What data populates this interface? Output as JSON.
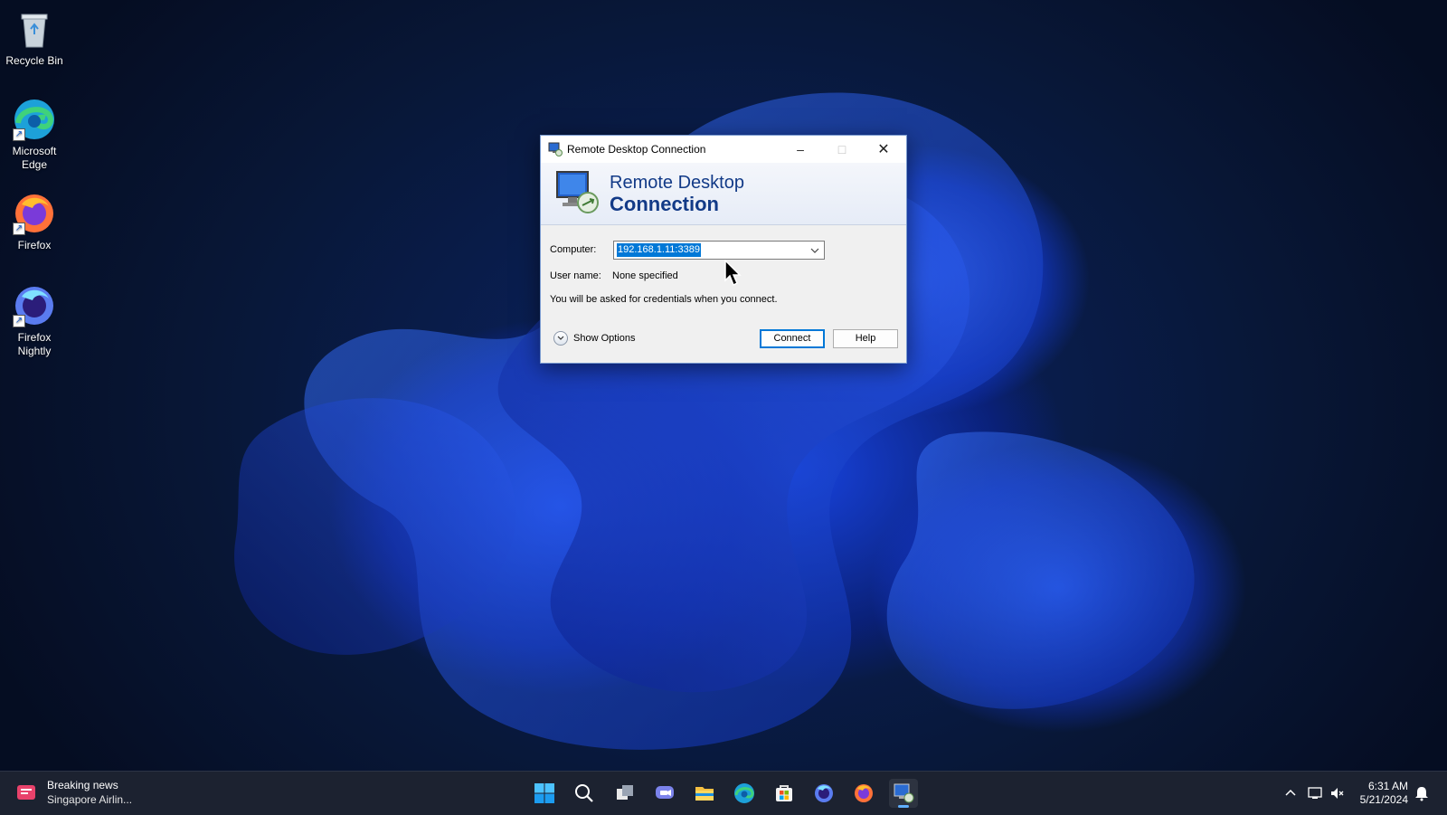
{
  "desktop": {
    "icons": [
      {
        "label": "Recycle Bin"
      },
      {
        "label": "Microsoft Edge"
      },
      {
        "label": "Firefox"
      },
      {
        "label": "Firefox Nightly"
      }
    ]
  },
  "dialog": {
    "title": "Remote Desktop Connection",
    "banner_line1": "Remote Desktop",
    "banner_line2": "Connection",
    "computer_label": "Computer:",
    "computer_value": "192.168.1.11:3389",
    "username_label": "User name:",
    "username_value": "None specified",
    "credentials_note": "You will be asked for credentials when you connect.",
    "show_options_label": "Show Options",
    "connect_label": "Connect",
    "help_label": "Help"
  },
  "taskbar": {
    "news_title": "Breaking news",
    "news_subtitle": "Singapore Airlin...",
    "apps": [
      "start-icon",
      "search-icon",
      "task-view-icon",
      "teams-chat-icon",
      "file-explorer-icon",
      "edge-icon",
      "microsoft-store-icon",
      "firefox-nightly-icon",
      "firefox-icon",
      "remote-desktop-icon"
    ],
    "time": "6:31 AM",
    "date": "5/21/2024"
  },
  "colors": {
    "accent": "#0078d7",
    "banner_text": "#123a87",
    "taskbar": "#1c2230"
  }
}
